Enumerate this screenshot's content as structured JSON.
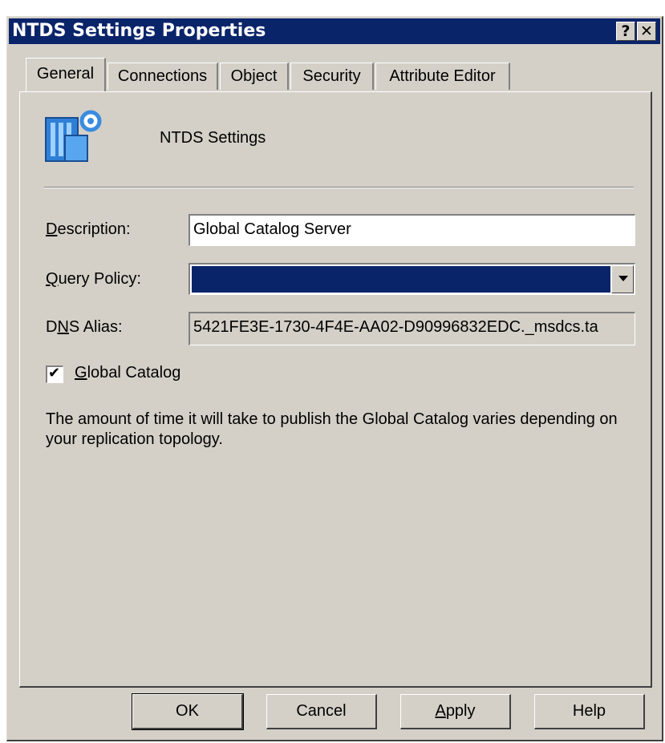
{
  "window": {
    "title": "NTDS Settings Properties",
    "help_glyph": "?",
    "close_glyph": "✕"
  },
  "tabs": [
    {
      "label": "General",
      "active": true
    },
    {
      "label": "Connections",
      "active": false
    },
    {
      "label": "Object",
      "active": false
    },
    {
      "label": "Security",
      "active": false
    },
    {
      "label": "Attribute Editor",
      "active": false
    }
  ],
  "general": {
    "object_icon": "ntds-settings-icon",
    "object_name": "NTDS Settings",
    "description": {
      "label_mnemonic": "D",
      "label_rest": "escription:",
      "value": "Global Catalog Server"
    },
    "query_policy": {
      "label_mnemonic": "Q",
      "label_rest": "uery Policy:",
      "value": ""
    },
    "dns_alias": {
      "label_pre": "D",
      "label_mnemonic": "N",
      "label_rest": "S Alias:",
      "value": "5421FE3E-1730-4F4E-AA02-D90996832EDC._msdcs.ta"
    },
    "global_catalog": {
      "label_mnemonic": "G",
      "label_rest": "lobal Catalog",
      "checked": true,
      "check_glyph": "✔"
    },
    "info_text": "The amount of time it will take to publish the Global Catalog varies depending on your replication topology."
  },
  "buttons": {
    "ok": "OK",
    "cancel": "Cancel",
    "apply_mnemonic": "A",
    "apply_rest": "pply",
    "help": "Help"
  },
  "colors": {
    "titlebar": "#0a246a",
    "dialog_face": "#d4d0c8",
    "selection": "#0a246a"
  }
}
